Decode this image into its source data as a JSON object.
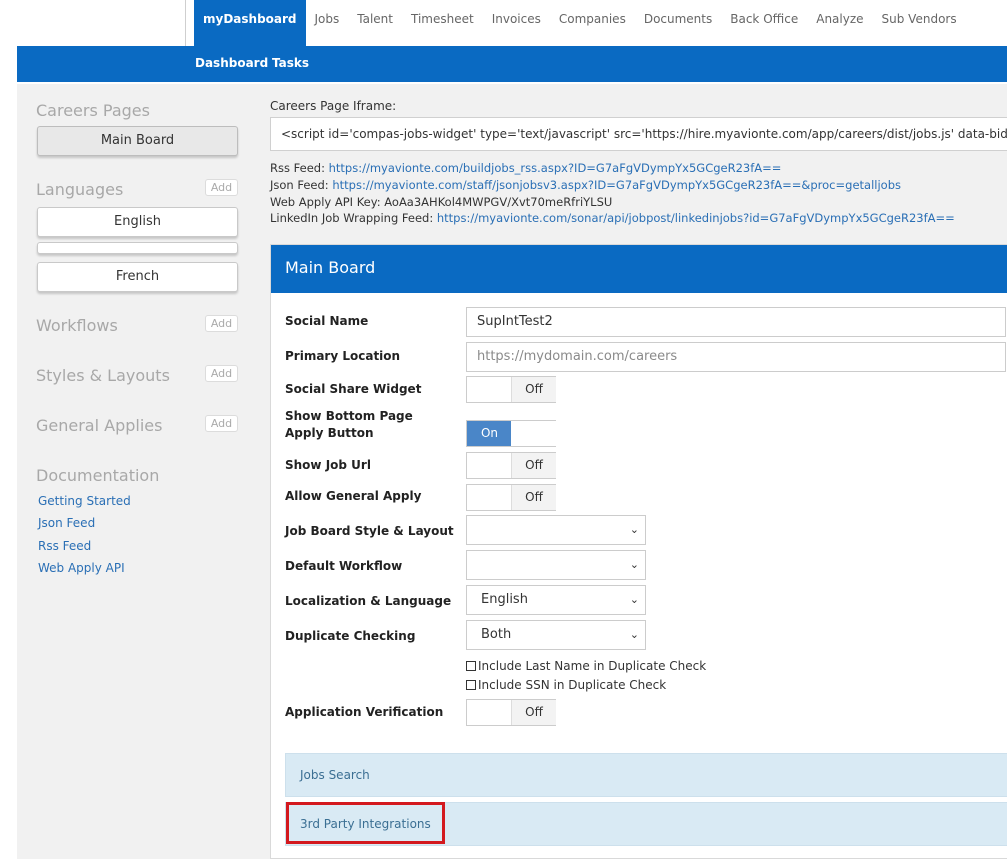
{
  "topnav": {
    "tabs": [
      "myDashboard",
      "Jobs",
      "Talent",
      "Timesheet",
      "Invoices",
      "Companies",
      "Documents",
      "Back Office",
      "Analyze",
      "Sub Vendors"
    ]
  },
  "subnav": {
    "items": [
      "Dashboard",
      "Tasks"
    ]
  },
  "sidebar": {
    "careers_pages": {
      "heading": "Careers Pages",
      "items": [
        "Main Board"
      ]
    },
    "languages": {
      "heading": "Languages",
      "add": "Add",
      "items": [
        "English",
        "",
        "French"
      ]
    },
    "workflows": {
      "heading": "Workflows",
      "add": "Add"
    },
    "styles": {
      "heading": "Styles & Layouts",
      "add": "Add"
    },
    "general_applies": {
      "heading": "General Applies",
      "add": "Add"
    },
    "documentation": {
      "heading": "Documentation",
      "links": [
        "Getting Started",
        "Json Feed",
        "Rss Feed",
        "Web Apply API"
      ]
    }
  },
  "main": {
    "iframe_label": "Careers Page Iframe:",
    "iframe_code": "<script id='compas-jobs-widget' type='text/javascript' src='https://hire.myavionte.com/app/careers/dist/jobs.js' data-bid='f",
    "rss": {
      "label": "Rss Feed: ",
      "url": "https://myavionte.com/buildjobs_rss.aspx?ID=G7aFgVDympYx5GCgeR23fA=="
    },
    "json": {
      "label": "Json Feed: ",
      "url": "https://myavionte.com/staff/jsonjobsv3.aspx?ID=G7aFgVDympYx5GCgeR23fA==&proc=getalljobs"
    },
    "api_key": "Web Apply API Key: AoAa3AHKol4MWPGV/Xvt70meRfriYLSU",
    "linkedin": {
      "label": "LinkedIn Job Wrapping Feed: ",
      "url": "https://myavionte.com/sonar/api/jobpost/linkedinjobs?id=G7aFgVDympYx5GCgeR23fA=="
    },
    "panel": {
      "title": "Main Board",
      "social_name": {
        "label": "Social Name",
        "value": "SupIntTest2"
      },
      "primary_location": {
        "label": "Primary Location",
        "placeholder": "https://mydomain.com/careers"
      },
      "social_share": {
        "label": "Social Share Widget",
        "state": "Off"
      },
      "bottom_apply": {
        "label": "Show Bottom Page Apply Button",
        "state": "On"
      },
      "job_url": {
        "label": "Show Job Url",
        "state": "Off"
      },
      "general_apply": {
        "label": "Allow General Apply",
        "state": "Off"
      },
      "style_layout": {
        "label": "Job Board Style & Layout",
        "value": ""
      },
      "workflow": {
        "label": "Default Workflow",
        "value": ""
      },
      "localization": {
        "label": "Localization & Language",
        "value": "English"
      },
      "duplicate": {
        "label": "Duplicate Checking",
        "value": "Both"
      },
      "cb_last_name": "Include Last Name in Duplicate Check",
      "cb_ssn": "Include SSN in Duplicate Check",
      "verification": {
        "label": "Application Verification",
        "state": "Off"
      },
      "accordions": [
        "Jobs Search",
        "3rd Party Integrations"
      ]
    }
  },
  "colors": {
    "brand_blue": "#0a6ac2",
    "toggle_on": "#4a86c8",
    "accordion_bg": "#d9eaf4",
    "highlight_red": "#d3191e"
  }
}
